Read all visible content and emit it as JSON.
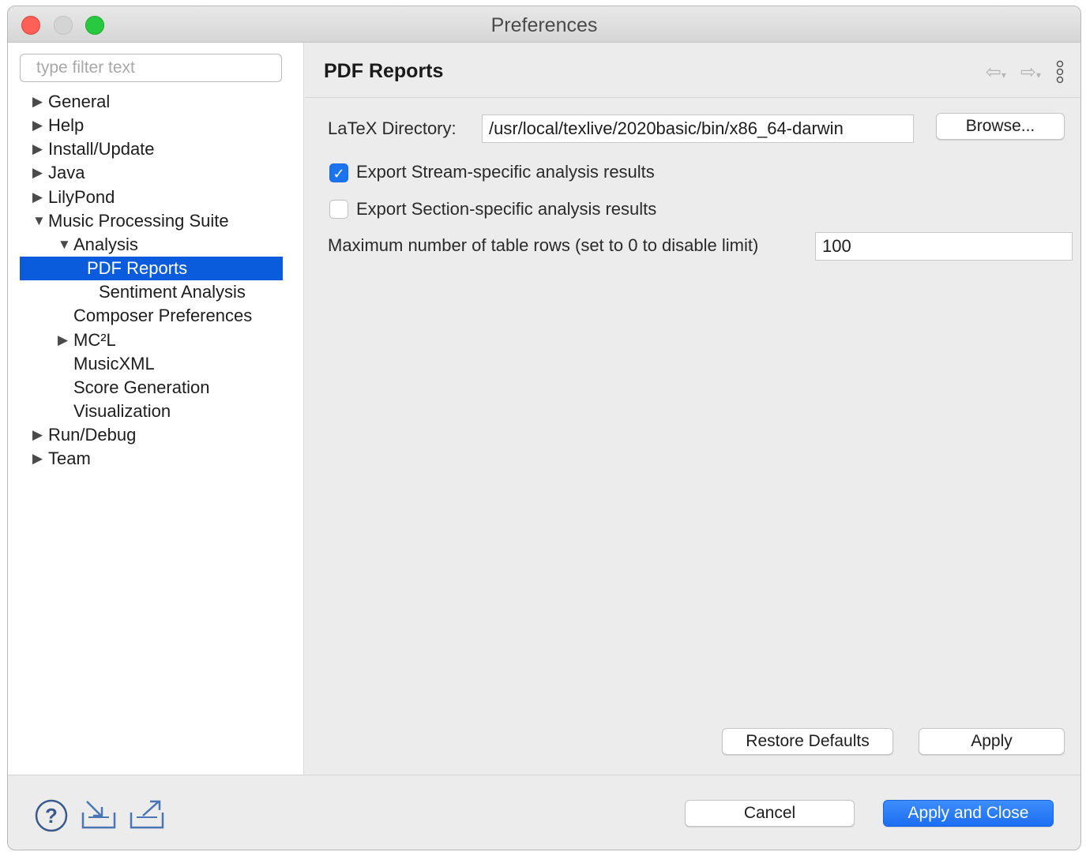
{
  "window": {
    "title": "Preferences"
  },
  "filter": {
    "placeholder": "type filter text",
    "value": ""
  },
  "tree": [
    {
      "label": "General",
      "arrow": "▶"
    },
    {
      "label": "Help",
      "arrow": "▶"
    },
    {
      "label": "Install/Update",
      "arrow": "▶"
    },
    {
      "label": "Java",
      "arrow": "▶"
    },
    {
      "label": "LilyPond",
      "arrow": "▶"
    },
    {
      "label": "Music Processing Suite",
      "arrow": "▼"
    },
    {
      "label": "Analysis",
      "arrow": "▼"
    },
    {
      "label": "PDF Reports",
      "arrow": "",
      "selected": true
    },
    {
      "label": "Sentiment Analysis",
      "arrow": ""
    },
    {
      "label": "Composer Preferences",
      "arrow": ""
    },
    {
      "label": "MC²L",
      "arrow": "▶"
    },
    {
      "label": "MusicXML",
      "arrow": ""
    },
    {
      "label": "Score Generation",
      "arrow": ""
    },
    {
      "label": "Visualization",
      "arrow": ""
    },
    {
      "label": "Run/Debug",
      "arrow": "▶"
    },
    {
      "label": "Team",
      "arrow": "▶"
    }
  ],
  "page": {
    "title": "PDF Reports",
    "latex_label": "LaTeX Directory:",
    "latex_value": "/usr/local/texlive/2020basic/bin/x86_64-darwin",
    "browse_label": "Browse...",
    "stream_label": "Export Stream-specific analysis results",
    "stream_checked": true,
    "section_label": "Export Section-specific analysis results",
    "section_checked": false,
    "maxrows_label": "Maximum number of table rows (set to 0 to disable limit)",
    "maxrows_value": "100",
    "restore_label": "Restore Defaults",
    "apply_label": "Apply"
  },
  "nav_icons": {
    "back": "back-arrow-icon",
    "forward": "forward-arrow-icon",
    "menu": "view-menu-icon"
  },
  "footer": {
    "cancel_label": "Cancel",
    "apply_close_label": "Apply and Close",
    "icons": [
      "help-icon",
      "import-icon",
      "export-icon"
    ]
  },
  "colors": {
    "selection": "#0a5cdc",
    "primary_button": "#1b6ef3",
    "checkbox": "#1b73f0"
  }
}
